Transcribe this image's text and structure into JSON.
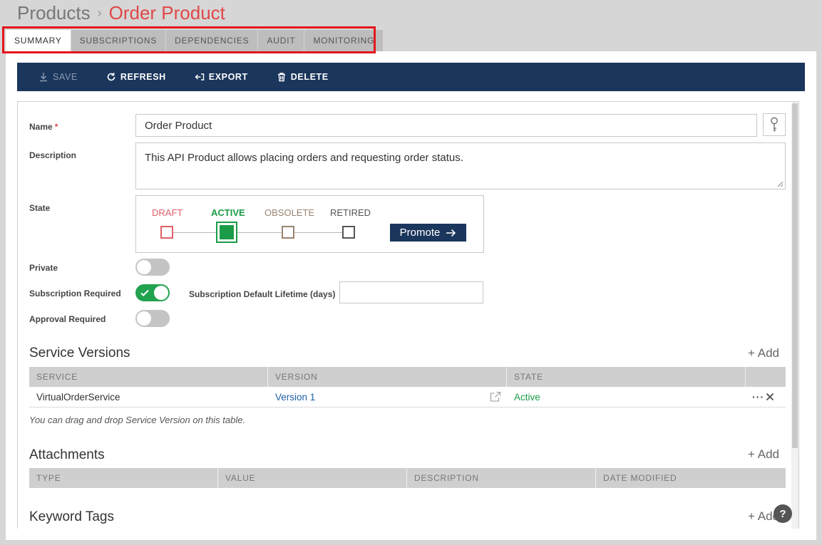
{
  "breadcrumb": {
    "parent": "Products",
    "separator": "›",
    "current": "Order Product"
  },
  "tabs": [
    {
      "label": "SUMMARY"
    },
    {
      "label": "SUBSCRIPTIONS"
    },
    {
      "label": "DEPENDENCIES"
    },
    {
      "label": "AUDIT"
    },
    {
      "label": "MONITORING"
    }
  ],
  "toolbar": {
    "save": "SAVE",
    "refresh": "REFRESH",
    "export": "EXPORT",
    "delete": "DELETE"
  },
  "form": {
    "name_label": "Name",
    "required_mark": "*",
    "name_value": "Order Product",
    "description_label": "Description",
    "description_value": "This API Product allows placing orders and requesting order status.",
    "state_label": "State",
    "states": [
      {
        "label": "DRAFT",
        "color": "#e0606a"
      },
      {
        "label": "ACTIVE",
        "color": "#1a9c48"
      },
      {
        "label": "OBSOLETE",
        "color": "#9a8471"
      },
      {
        "label": "RETIRED",
        "color": "#555555"
      }
    ],
    "current_state": "ACTIVE",
    "promote_label": "Promote",
    "private_label": "Private",
    "private_on": false,
    "subscription_required_label": "Subscription Required",
    "subscription_required_on": true,
    "subscription_lifetime_label": "Subscription Default Lifetime (days)",
    "subscription_lifetime_value": "",
    "approval_required_label": "Approval Required",
    "approval_required_on": false
  },
  "service_versions": {
    "title": "Service Versions",
    "add_label": "+ Add",
    "headers": [
      "SERVICE",
      "VERSION",
      "STATE"
    ],
    "rows": [
      {
        "service": "VirtualOrderService",
        "version": "Version 1",
        "state": "Active"
      }
    ],
    "hint": "You can drag and drop Service Version on this table."
  },
  "attachments": {
    "title": "Attachments",
    "add_label": "+ Add",
    "headers": [
      "TYPE",
      "VALUE",
      "DESCRIPTION",
      "DATE MODIFIED"
    ]
  },
  "keyword_tags": {
    "title": "Keyword Tags",
    "add_label": "+ Add"
  },
  "help_label": "?",
  "colors": {
    "accent": "#1b365c",
    "danger": "#e04848",
    "success": "#1a9c48",
    "link": "#1f5fa8"
  }
}
